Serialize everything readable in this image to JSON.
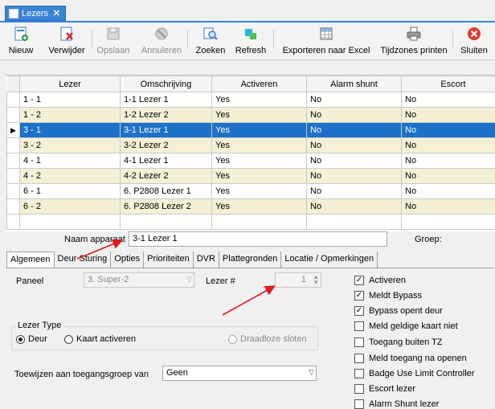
{
  "doc_tab": {
    "label": "Lezers",
    "close": "✕"
  },
  "toolbar": {
    "buttons": [
      {
        "label": "Nieuw"
      },
      {
        "label": "Verwijder"
      },
      {
        "label": "Opslaan"
      },
      {
        "label": "Annuleren"
      },
      {
        "label": "Zoeken"
      },
      {
        "label": "Refresh"
      },
      {
        "label": "Exporteren naar Excel"
      },
      {
        "label": "Tijdzones printen"
      },
      {
        "label": "Sluiten"
      }
    ]
  },
  "grid": {
    "columns": [
      "Lezer",
      "Omschrijving",
      "Activeren",
      "Alarm shunt",
      "Escort"
    ],
    "rows": [
      {
        "lezer": "1 - 1",
        "omschrijving": "1-1 Lezer 1",
        "activeren": "Yes",
        "alarm": "No",
        "escort": "No"
      },
      {
        "lezer": "1 - 2",
        "omschrijving": "1-2 Lezer 2",
        "activeren": "Yes",
        "alarm": "No",
        "escort": "No"
      },
      {
        "lezer": "3 - 1",
        "omschrijving": "3-1 Lezer 1",
        "activeren": "Yes",
        "alarm": "No",
        "escort": "No"
      },
      {
        "lezer": "3 - 2",
        "omschrijving": "3-2 Lezer 2",
        "activeren": "Yes",
        "alarm": "No",
        "escort": "No"
      },
      {
        "lezer": "4 - 1",
        "omschrijving": "4-1 Lezer 1",
        "activeren": "Yes",
        "alarm": "No",
        "escort": "No"
      },
      {
        "lezer": "4 - 2",
        "omschrijving": "4-2 Lezer 2",
        "activeren": "Yes",
        "alarm": "No",
        "escort": "No"
      },
      {
        "lezer": "6 - 1",
        "omschrijving": "6. P2808 Lezer 1",
        "activeren": "Yes",
        "alarm": "No",
        "escort": "No"
      },
      {
        "lezer": "6 - 2",
        "omschrijving": "6. P2808 Lezer 2",
        "activeren": "Yes",
        "alarm": "No",
        "escort": "No"
      }
    ],
    "current_row_marker": "▶"
  },
  "detail": {
    "naam_label": "Naam apparaat",
    "naam_value": "3-1 Lezer 1",
    "groep_label": "Groep:",
    "tabs": [
      "Algemeen",
      "Deur Sturing",
      "Opties",
      "Prioriteiten",
      "DVR",
      "Plattegronden",
      "Locatie / Opmerkingen"
    ],
    "paneel_label": "Paneel",
    "paneel_value": "3. Super-2",
    "lezer_label": "Lezer #",
    "lezer_value": "1",
    "lezer_type_label": "Lezer Type",
    "radio_deur": "Deur",
    "radio_kaart": "Kaart activeren",
    "radio_draadloze": "Draadloze sloten",
    "toewijzen_label": "Toewijzen aan toegangsgroep van",
    "toewijzen_value": "Geen",
    "checkboxes": [
      {
        "label": "Activeren",
        "checked": true
      },
      {
        "label": "Meldt Bypass",
        "checked": true
      },
      {
        "label": "Bypass opent deur",
        "checked": true
      },
      {
        "label": "Meld geldige kaart niet",
        "checked": false
      },
      {
        "label": "Toegang buiten TZ",
        "checked": false
      },
      {
        "label": "Meld toegang na openen",
        "checked": false
      },
      {
        "label": "Badge Use Limit Controller",
        "checked": false
      },
      {
        "label": "Escort lezer",
        "checked": false
      },
      {
        "label": "Alarm Shunt lezer",
        "checked": false
      }
    ]
  },
  "colors": {
    "selection": "#1d71c8",
    "alt_row": "#f3f0d6",
    "tab_blue": "#3a84d8",
    "arrow_red": "#e01a1a"
  }
}
